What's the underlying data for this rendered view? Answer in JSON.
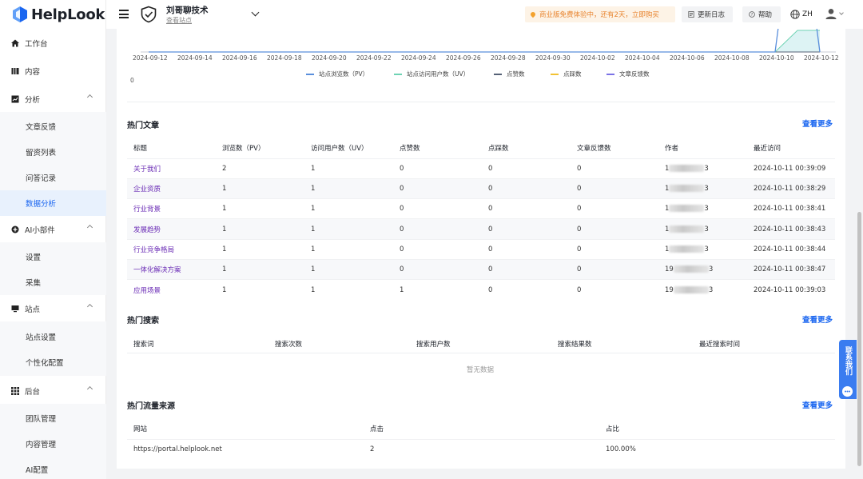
{
  "app": {
    "name": "HelpLook"
  },
  "colors": {
    "accent": "#1a66f0",
    "uv": "#3aa0e8",
    "link": "#6a2bb5",
    "promo": "#e8842f"
  },
  "sidebar": {
    "items": [
      {
        "label": "工作台",
        "icon": "home-icon"
      },
      {
        "label": "内容",
        "icon": "book-icon"
      },
      {
        "label": "分析",
        "icon": "chart-icon",
        "expanded": true,
        "children": [
          "文章反馈",
          "留资列表",
          "问答记录",
          "数据分析"
        ],
        "active_child": "数据分析"
      },
      {
        "label": "AI小部件",
        "icon": "plus-circle-icon",
        "expanded": true,
        "children": [
          "设置",
          "采集"
        ]
      },
      {
        "label": "站点",
        "icon": "monitor-icon",
        "expanded": true,
        "children": [
          "站点设置",
          "个性化配置"
        ]
      },
      {
        "label": "后台",
        "icon": "grid-icon",
        "expanded": true,
        "children": [
          "团队管理",
          "内容管理",
          "AI配置"
        ]
      }
    ]
  },
  "header": {
    "site_name": "刘哥聊技术",
    "site_view": "查看站点",
    "promo": "商业版免费体验中，还有2天，立即购买",
    "changelog": "更新日志",
    "help": "帮助",
    "lang": "ZH"
  },
  "chart_data": {
    "type": "line",
    "ylim": [
      0,
      2
    ],
    "ylabel_min": "0",
    "x": [
      "2024-09-12",
      "2024-09-13",
      "2024-09-14",
      "2024-09-15",
      "2024-09-16",
      "2024-09-17",
      "2024-09-18",
      "2024-09-19",
      "2024-09-20",
      "2024-09-21",
      "2024-09-22",
      "2024-09-23",
      "2024-09-24",
      "2024-09-25",
      "2024-09-26",
      "2024-09-27",
      "2024-09-28",
      "2024-09-29",
      "2024-09-30",
      "2024-10-01",
      "2024-10-02",
      "2024-10-03",
      "2024-10-04",
      "2024-10-05",
      "2024-10-06",
      "2024-10-07",
      "2024-10-08",
      "2024-10-09",
      "2024-10-10",
      "2024-10-11",
      "2024-10-12"
    ],
    "xtick_labels": [
      "2024-09-12",
      "2024-09-14",
      "2024-09-16",
      "2024-09-18",
      "2024-09-20",
      "2024-09-22",
      "2024-09-24",
      "2024-09-26",
      "2024-09-28",
      "2024-09-30",
      "2024-10-02",
      "2024-10-04",
      "2024-10-06",
      "2024-10-08",
      "2024-10-10",
      "2024-10-12"
    ],
    "series": [
      {
        "name": "站点浏览数（PV）",
        "color": "#5a8fdc",
        "values": [
          0,
          0,
          0,
          0,
          0,
          0,
          0,
          0,
          0,
          0,
          0,
          0,
          0,
          0,
          0,
          0,
          0,
          0,
          0,
          0,
          0,
          0,
          0,
          0,
          0,
          0,
          0,
          0,
          0,
          8,
          0
        ]
      },
      {
        "name": "站点访问用户数（UV）",
        "color": "#6fd3b4",
        "values": [
          0,
          0,
          0,
          0,
          0,
          0,
          0,
          0,
          0,
          0,
          0,
          0,
          0,
          0,
          0,
          0,
          0,
          0,
          0,
          0,
          0,
          0,
          0,
          0,
          0,
          0,
          0,
          0,
          0,
          1,
          1
        ]
      },
      {
        "name": "点赞数",
        "color": "#556176",
        "values": [
          0,
          0,
          0,
          0,
          0,
          0,
          0,
          0,
          0,
          0,
          0,
          0,
          0,
          0,
          0,
          0,
          0,
          0,
          0,
          0,
          0,
          0,
          0,
          0,
          0,
          0,
          0,
          0,
          0,
          0,
          0
        ]
      },
      {
        "name": "点踩数",
        "color": "#f2c233",
        "values": [
          0,
          0,
          0,
          0,
          0,
          0,
          0,
          0,
          0,
          0,
          0,
          0,
          0,
          0,
          0,
          0,
          0,
          0,
          0,
          0,
          0,
          0,
          0,
          0,
          0,
          0,
          0,
          0,
          0,
          0,
          0
        ]
      },
      {
        "name": "文章反馈数",
        "color": "#7b72e6",
        "values": [
          0,
          0,
          0,
          0,
          0,
          0,
          0,
          0,
          0,
          0,
          0,
          0,
          0,
          0,
          0,
          0,
          0,
          0,
          0,
          0,
          0,
          0,
          0,
          0,
          0,
          0,
          0,
          0,
          0,
          0,
          0
        ]
      }
    ]
  },
  "hot_articles": {
    "title": "热门文章",
    "more": "查看更多",
    "columns": [
      "标题",
      "浏览数（PV）",
      "访问用户数（UV）",
      "点赞数",
      "点踩数",
      "文章反馈数",
      "作者",
      "最近访问"
    ],
    "rows": [
      {
        "title": "关于我们",
        "pv": "2",
        "uv": "1",
        "likes": "0",
        "dislikes": "0",
        "feedback": "0",
        "author_prefix": "1",
        "author_suffix": "3",
        "last": "2024-10-11 00:39:09"
      },
      {
        "title": "企业资质",
        "pv": "1",
        "uv": "1",
        "likes": "0",
        "dislikes": "0",
        "feedback": "0",
        "author_prefix": "1",
        "author_suffix": "3",
        "last": "2024-10-11 00:38:29"
      },
      {
        "title": "行业背景",
        "pv": "1",
        "uv": "1",
        "likes": "0",
        "dislikes": "0",
        "feedback": "0",
        "author_prefix": "1",
        "author_suffix": "3",
        "last": "2024-10-11 00:38:41"
      },
      {
        "title": "发展趋势",
        "pv": "1",
        "uv": "1",
        "likes": "0",
        "dislikes": "0",
        "feedback": "0",
        "author_prefix": "1",
        "author_suffix": "3",
        "last": "2024-10-11 00:38:43"
      },
      {
        "title": "行业竞争格局",
        "pv": "1",
        "uv": "1",
        "likes": "0",
        "dislikes": "0",
        "feedback": "0",
        "author_prefix": "1",
        "author_suffix": "3",
        "last": "2024-10-11 00:38:44"
      },
      {
        "title": "一体化解决方案",
        "pv": "1",
        "uv": "1",
        "likes": "0",
        "dislikes": "0",
        "feedback": "0",
        "author_prefix": "19",
        "author_suffix": "3",
        "last": "2024-10-11 00:38:47"
      },
      {
        "title": "应用场景",
        "pv": "1",
        "uv": "1",
        "likes": "1",
        "dislikes": "0",
        "feedback": "0",
        "author_prefix": "19",
        "author_suffix": "3",
        "last": "2024-10-11 00:39:03"
      }
    ]
  },
  "hot_search": {
    "title": "热门搜索",
    "more": "查看更多",
    "columns": [
      "搜索词",
      "搜索次数",
      "搜索用户数",
      "搜索结果数",
      "最近搜索时间"
    ],
    "empty": "暂无数据"
  },
  "hot_sources": {
    "title": "热门流量来源",
    "more": "查看更多",
    "columns": [
      "网站",
      "点击",
      "占比"
    ],
    "rows": [
      {
        "site": "https://portal.helplook.net",
        "clicks": "2",
        "ratio": "100.00%"
      }
    ]
  },
  "contact": {
    "label": "联系我们"
  }
}
